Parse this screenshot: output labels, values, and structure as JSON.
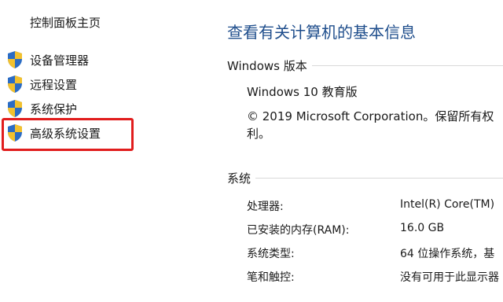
{
  "sidebar": {
    "home_label": "控制面板主页",
    "items": [
      {
        "label": "设备管理器",
        "icon": "shield-icon"
      },
      {
        "label": "远程设置",
        "icon": "shield-icon"
      },
      {
        "label": "系统保护",
        "icon": "shield-icon"
      },
      {
        "label": "高级系统设置",
        "icon": "shield-icon"
      }
    ],
    "highlight_color": "#e11d1d"
  },
  "main": {
    "title": "查看有关计算机的基本信息",
    "windows_section": {
      "header": "Windows 版本",
      "edition": "Windows 10 教育版",
      "copyright": "© 2019 Microsoft Corporation。保留所有权利。"
    },
    "system_section": {
      "header": "系统",
      "rows": [
        {
          "key": "处理器:",
          "value": "Intel(R) Core(TM)"
        },
        {
          "key": "已安装的内存(RAM):",
          "value": "16.0 GB"
        },
        {
          "key": "系统类型:",
          "value": "64 位操作系统，基"
        },
        {
          "key": "笔和触控:",
          "value": "没有可用于此显示器"
        }
      ]
    }
  },
  "colors": {
    "title_blue": "#1f4e8c",
    "shield_blue": "#2b6cc4",
    "shield_yellow": "#f2c12e"
  }
}
